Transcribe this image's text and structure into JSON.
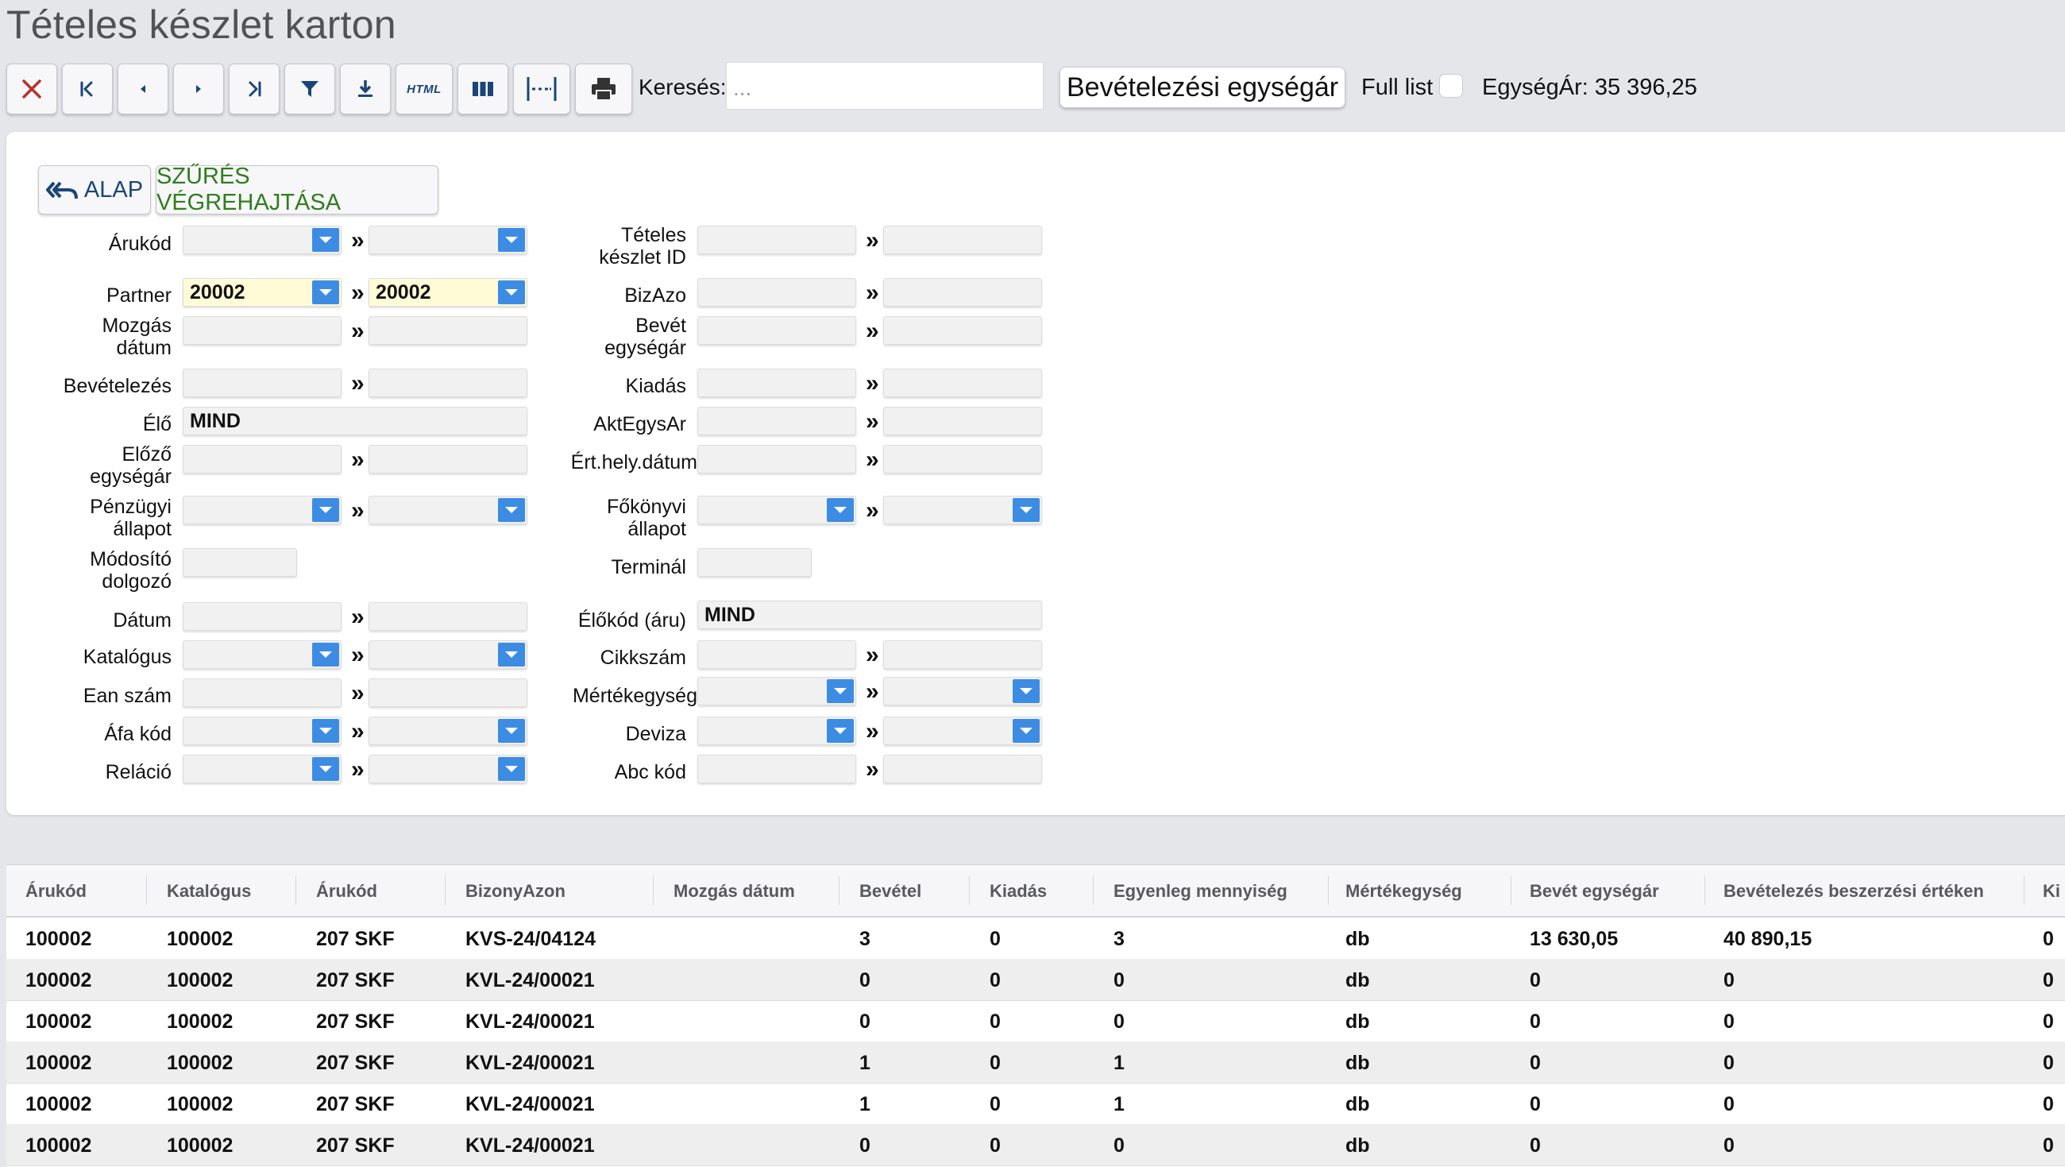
{
  "title": "Tételes készlet karton",
  "toolbar": {
    "buttons": [
      "close",
      "first",
      "previous",
      "next",
      "last",
      "filter",
      "download",
      "html",
      "columns",
      "column-width",
      "print"
    ],
    "html_label": "HTML"
  },
  "search": {
    "label": "Keresés:",
    "placeholder": "..."
  },
  "field_select": {
    "value": "Bevételezési egységár"
  },
  "full_list": {
    "label": "Full list",
    "checked": false
  },
  "unit_price": {
    "text": "EgységÁr: 35 396,25"
  },
  "filter": {
    "alap_label": "ALAP",
    "execute_label": "SZŰRÉS VÉGREHAJTÁSA",
    "left": {
      "arukod": "Árukód",
      "partner": "Partner",
      "partner_from": "20002",
      "partner_to": "20002",
      "mozgas_datum": [
        "Mozgás",
        "dátum"
      ],
      "bevetelezes": "Bevételezés",
      "elo": "Élő",
      "elo_value": "MIND",
      "elozo_egysegar": [
        "Előző",
        "egységár"
      ],
      "penzugyi_allapot": [
        "Pénzügyi",
        "állapot"
      ],
      "modosito_dolgozo": [
        "Módosító",
        "dolgozó"
      ],
      "datum": "Dátum",
      "katalogus": "Katalógus",
      "ean_szam": "Ean szám",
      "afa_kod": "Áfa kód",
      "relacio": "Reláció"
    },
    "right": {
      "teteles_keszlet_id": [
        "Tételes",
        "készlet ID"
      ],
      "bizazo": "BizAzo",
      "bevet_egysegar": [
        "Bevét",
        "egységár"
      ],
      "kiadas": "Kiadás",
      "aktegysar": "AktEgysAr",
      "ert_hely_datum": "Ért.hely.dátum",
      "fokonyvi_allapot": [
        "Főkönyvi",
        "állapot"
      ],
      "terminal": "Terminál",
      "elokod_aru": "Élőkód (áru)",
      "elokod_value": "MIND",
      "cikkszam": "Cikkszám",
      "mertekegyseg": "Mértékegység",
      "deviza": "Deviza",
      "abc_kod": "Abc kód"
    },
    "range_sep": "»"
  },
  "table": {
    "columns": [
      "Árukód",
      "Katalógus",
      "Árukód",
      "BizonyAzon",
      "Mozgás dátum",
      "Bevétel",
      "Kiadás",
      "Egyenleg mennyiség",
      "Mértékegység",
      "Bevét egységár",
      "Bevételezés beszerzési értéken",
      "Ki"
    ],
    "rows": [
      [
        "100002",
        "100002",
        "207 SKF",
        "KVS-24/04124",
        "",
        "3",
        "0",
        "3",
        "db",
        "13 630,05",
        "40 890,15",
        "0"
      ],
      [
        "100002",
        "100002",
        "207 SKF",
        "KVL-24/00021",
        "",
        "0",
        "0",
        "0",
        "db",
        "0",
        "0",
        "0"
      ],
      [
        "100002",
        "100002",
        "207 SKF",
        "KVL-24/00021",
        "",
        "0",
        "0",
        "0",
        "db",
        "0",
        "0",
        "0"
      ],
      [
        "100002",
        "100002",
        "207 SKF",
        "KVL-24/00021",
        "",
        "1",
        "0",
        "1",
        "db",
        "0",
        "0",
        "0"
      ],
      [
        "100002",
        "100002",
        "207 SKF",
        "KVL-24/00021",
        "",
        "1",
        "0",
        "1",
        "db",
        "0",
        "0",
        "0"
      ],
      [
        "100002",
        "100002",
        "207 SKF",
        "KVL-24/00021",
        "",
        "0",
        "0",
        "0",
        "db",
        "0",
        "0",
        "0"
      ]
    ]
  }
}
